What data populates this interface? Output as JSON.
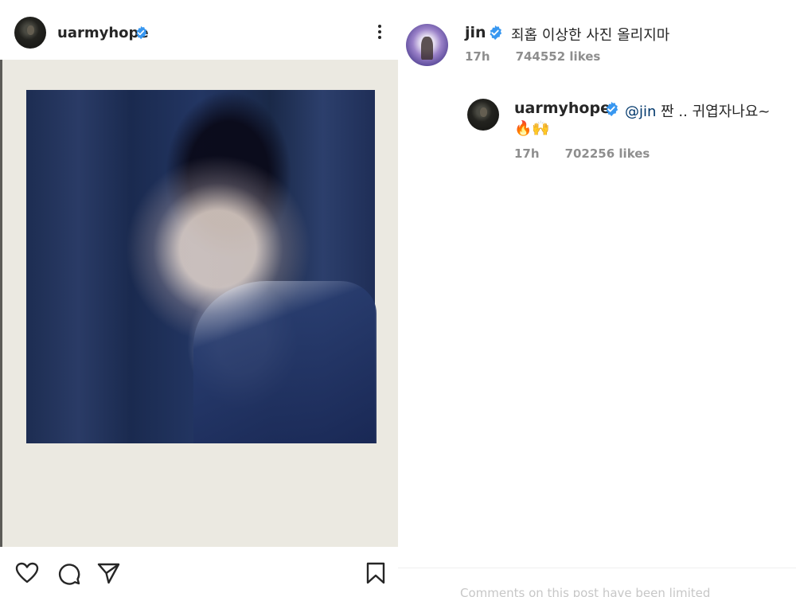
{
  "post": {
    "author": "uarmyhope",
    "author_verified": true,
    "more_icon": "more-vertical-icon",
    "actions": [
      {
        "name": "like-icon"
      },
      {
        "name": "comment-icon"
      },
      {
        "name": "share-icon"
      },
      {
        "name": "save-icon"
      }
    ]
  },
  "comments": [
    {
      "username": "jin",
      "verified": true,
      "text": "죄홉 이상한 사진 올리지마",
      "time": "17h",
      "likes": "744552 likes"
    },
    {
      "username": "uarmyhope",
      "verified": true,
      "mention": "@jin",
      "text": " 짠 .. 귀엽자나요~",
      "emojis": "🔥🙌",
      "time": "17h",
      "likes": "702256 likes"
    }
  ],
  "footer": {
    "limited_notice": "Comments on this post have been limited"
  },
  "colors": {
    "verified": "#3897f0",
    "mention": "#00376b",
    "meta": "#8e8e8e"
  }
}
